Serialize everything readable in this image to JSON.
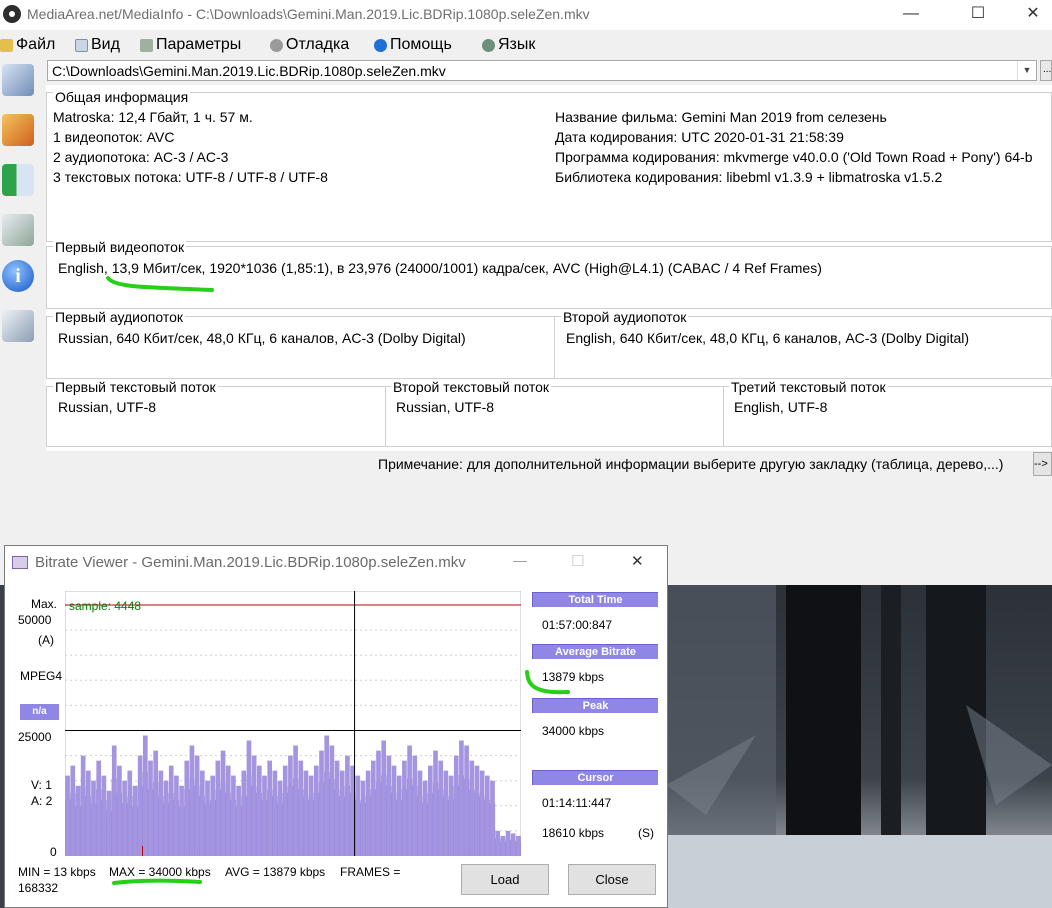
{
  "window": {
    "title": "MediaArea.net/MediaInfo - C:\\Downloads\\Gemini.Man.2019.Lic.BDRip.1080p.seleZen.mkv",
    "minimize_glyph": "—",
    "maximize_glyph": "☐",
    "close_glyph": "✕"
  },
  "menu": [
    {
      "label": "Файл",
      "icon": "folder-icon"
    },
    {
      "label": "Вид",
      "icon": "view-icon"
    },
    {
      "label": "Параметры",
      "icon": "settings-icon"
    },
    {
      "label": "Отладка",
      "icon": "debug-icon"
    },
    {
      "label": "Помощь",
      "icon": "help-icon"
    },
    {
      "label": "Язык",
      "icon": "globe-icon"
    }
  ],
  "toolbar": [
    "open-file-icon",
    "open-folder-icon",
    "export-icon",
    "preferences-icon",
    "about-icon",
    "knowledge-icon"
  ],
  "file_combo": {
    "value": "C:\\Downloads\\Gemini.Man.2019.Lic.BDRip.1080p.seleZen.mkv",
    "browse": "..."
  },
  "general": {
    "title": "Общая информация",
    "left": [
      "Matroska: 12,4 Гбайт, 1 ч. 57 м.",
      "1 видеопоток: AVC",
      "2 аудиопотока: AC-3 / AC-3",
      "3 текстовых потока: UTF-8 / UTF-8 / UTF-8"
    ],
    "right": [
      "Название фильма: Gemini Man 2019 from селезень",
      "Дата кодирования: UTC 2020-01-31 21:58:39",
      "Программа кодирования: mkvmerge v40.0.0 ('Old Town Road + Pony') 64-b",
      "Библиотека кодирования: libebml v1.3.9 + libmatroska v1.5.2"
    ]
  },
  "video": {
    "title": "Первый видеопоток",
    "text": "English, 13,9 Мбит/сек, 1920*1036 (1,85:1), в 23,976 (24000/1001) кадра/сек, AVC (High@L4.1) (CABAC / 4 Ref Frames)"
  },
  "audio": [
    {
      "title": "Первый аудиопоток",
      "text": "Russian, 640 Кбит/сек, 48,0 КГц, 6 каналов, AC-3 (Dolby Digital)"
    },
    {
      "title": "Второй аудиопоток",
      "text": "English, 640 Кбит/сек, 48,0 КГц, 6 каналов, AC-3 (Dolby Digital)"
    }
  ],
  "text_streams": [
    {
      "title": "Первый текстовый поток",
      "text": "Russian, UTF-8"
    },
    {
      "title": "Второй текстовый поток",
      "text": "Russian, UTF-8"
    },
    {
      "title": "Третий текстовый поток",
      "text": "English, UTF-8"
    }
  ],
  "note": {
    "text": "Примечание: для дополнительной информации выберите другую закладку (таблица, дерево,...)",
    "button": "-->"
  },
  "bitrate_viewer": {
    "title": "Bitrate Viewer - Gemini.Man.2019.Lic.BDRip.1080p.seleZen.mkv",
    "close_glyph": "✕",
    "max_glyph": "☐",
    "min_glyph": "—",
    "axis": {
      "max_label": "Max.",
      "y_top": "50000",
      "a_label": "(A)",
      "codec": "MPEG4",
      "tag": "n/a",
      "y_mid": "25000",
      "v_label": "V:  1",
      "a_count": "A:  2",
      "y_zero": "0"
    },
    "sample": "sample: 4448",
    "stats": {
      "total_time_label": "Total Time",
      "total_time": "01:57:00:847",
      "avg_label": "Average Bitrate",
      "avg": "13879 kbps",
      "peak_label": "Peak",
      "peak": "34000 kbps",
      "cursor_label": "Cursor",
      "cursor_time": "01:14:11:447",
      "cursor_rate": "18610 kbps",
      "cursor_flag": "(S)"
    },
    "footer": {
      "min": "MIN = 13 kbps",
      "max": "MAX = 34000 kbps",
      "avg": "AVG = 13879 kbps",
      "frames": "FRAMES =",
      "frames_value": "168332"
    },
    "buttons": {
      "load": "Load",
      "close": "Close"
    }
  },
  "colors": {
    "accent": "#8f86e6",
    "annotation": "#27d018",
    "bar_fill": "#a594e0",
    "chart_red": "#c00000"
  },
  "chart_data": {
    "type": "area",
    "title": "",
    "ylim": [
      0,
      50000
    ],
    "y_ticks": [
      0,
      25000,
      50000
    ],
    "reference_lines": {
      "max": 50000,
      "mid": 25000
    },
    "series": [
      {
        "name": "",
        "values": [
          16000,
          18000,
          14000,
          20000,
          17000,
          15000,
          19000,
          16000,
          13000,
          22000,
          18000,
          15000,
          17000,
          14000,
          20000,
          24000,
          19000,
          21000,
          17000,
          15000,
          18000,
          16000,
          14000,
          19000,
          22000,
          20000,
          17000,
          15000,
          16000,
          19000,
          21000,
          18000,
          16000,
          14000,
          17000,
          23000,
          20000,
          18000,
          16000,
          19000,
          17000,
          15000,
          18000,
          20000,
          22000,
          19000,
          17000,
          16000,
          18000,
          21000,
          24000,
          22000,
          19000,
          17000,
          20000,
          18000,
          16000,
          15000,
          17000,
          19000,
          21000,
          23000,
          20000,
          18000,
          16000,
          19000,
          22000,
          20000,
          17000,
          15000,
          18000,
          21000,
          19000,
          17000,
          16000,
          20000,
          23000,
          22000,
          19000,
          18000,
          17000,
          16000,
          15000,
          5000,
          4000,
          5000,
          4500,
          4000
        ]
      }
    ],
    "cursor_position_time": "01:14:11:447"
  }
}
